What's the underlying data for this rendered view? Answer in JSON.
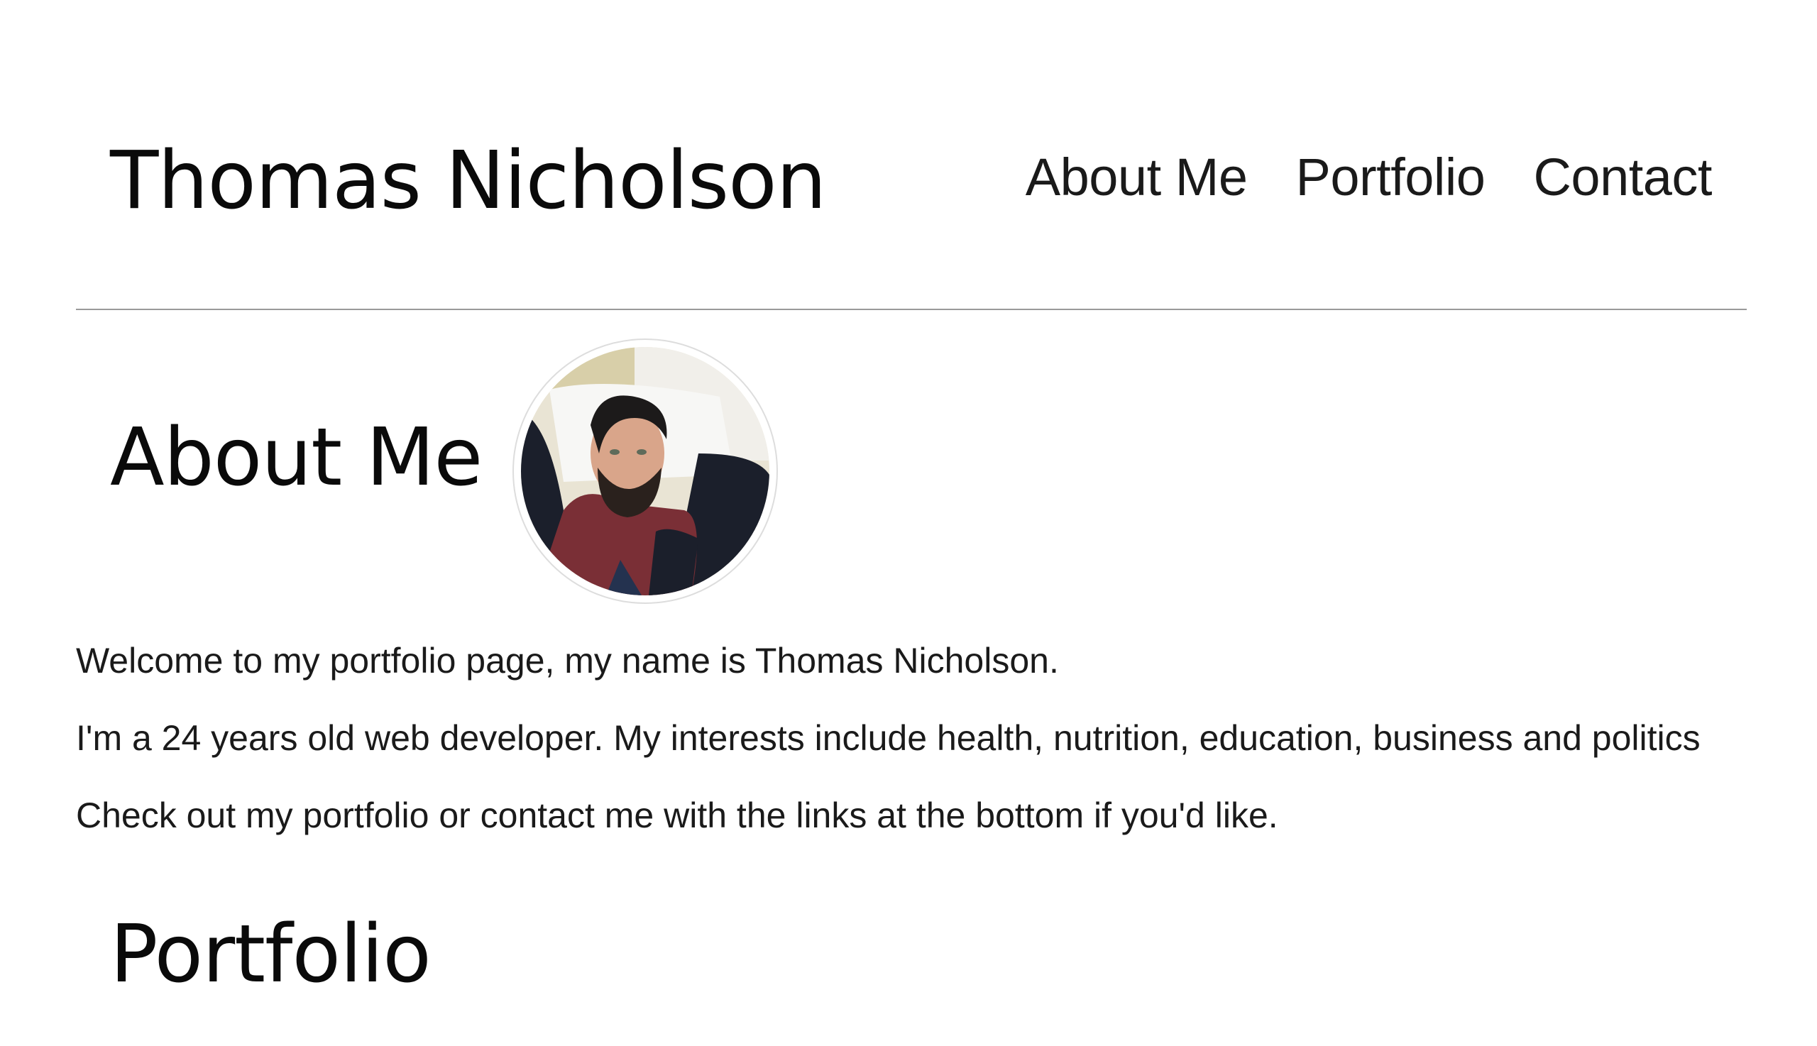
{
  "header": {
    "site_title": "Thomas Nicholson",
    "nav": [
      {
        "label": "About Me"
      },
      {
        "label": "Portfolio"
      },
      {
        "label": "Contact"
      }
    ]
  },
  "about": {
    "heading": "About Me",
    "avatar_alt": "profile photo",
    "paragraphs": [
      "Welcome to my portfolio page, my name is Thomas Nicholson.",
      "I'm a 24 years old web developer. My interests include health, nutrition, education, business and politics",
      "Check out my portfolio or contact me with the links at the bottom if you'd like."
    ]
  },
  "portfolio": {
    "heading": "Portfolio"
  },
  "colors": {
    "text": "#111111",
    "divider": "#9a9a9a",
    "background": "#ffffff"
  }
}
